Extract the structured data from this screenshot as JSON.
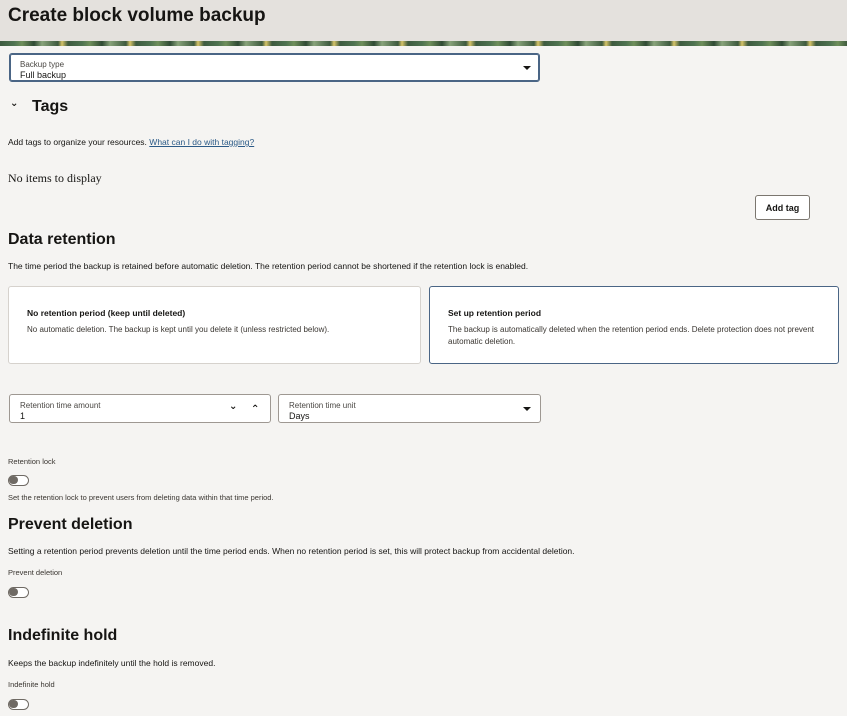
{
  "header": {
    "title": "Create block volume backup"
  },
  "backup_type": {
    "label": "Backup type",
    "value": "Full backup"
  },
  "tags": {
    "heading": "Tags",
    "description": "Add tags to organize your resources.",
    "help_link": "What can I do with tagging?",
    "empty_text": "No items to display",
    "add_button": "Add tag"
  },
  "retention": {
    "heading": "Data retention",
    "description": "The time period the backup is retained before automatic deletion. The retention period cannot be shortened if the retention lock is enabled.",
    "options": [
      {
        "title": "No retention period (keep until deleted)",
        "description": "No automatic deletion. The backup is kept until you delete it (unless restricted below).",
        "selected": false
      },
      {
        "title": "Set up retention period",
        "description": "The backup is automatically deleted when the retention period ends. Delete protection does not prevent automatic deletion.",
        "selected": true
      }
    ],
    "amount": {
      "label": "Retention time amount",
      "value": "1"
    },
    "unit": {
      "label": "Retention time unit",
      "value": "Days"
    },
    "lock": {
      "label": "Retention lock",
      "help": "Set the retention lock to prevent users from deleting data within that time period."
    }
  },
  "prevent_deletion": {
    "heading": "Prevent deletion",
    "description": "Setting a retention period prevents deletion until the time period ends. When no retention period is set, this will protect backup from accidental deletion.",
    "toggle_label": "Prevent deletion"
  },
  "indefinite_hold": {
    "heading": "Indefinite hold",
    "description": "Keeps the backup indefinitely until the hold is removed.",
    "toggle_label": "Indefinite hold"
  },
  "colors": {
    "accent": "#4a6585",
    "link": "#2b5a87",
    "background": "#f5f4f2"
  }
}
